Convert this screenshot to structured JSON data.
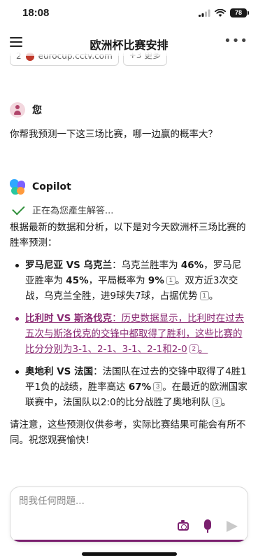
{
  "status_bar": {
    "time": "18:08",
    "battery": "78"
  },
  "header": {
    "title": "欧洲杯比赛安排"
  },
  "sources": [
    {
      "num": "2",
      "label": "eurocup.cctv.com"
    },
    {
      "num": "",
      "label": "+3 更多"
    }
  ],
  "user": {
    "name": "您",
    "message": "你帮我预测一下这三场比赛，哪一边赢的概率大？"
  },
  "copilot": {
    "name": "Copilot",
    "status": "正在為您產生解答...",
    "intro": "根据最新的数据和分析，以下是对今天欧洲杯三场比赛的胜率预测：",
    "items": [
      {
        "title": "罗马尼亚 VS 乌克兰",
        "t1": "：乌克兰胜率为 ",
        "p1": "46%",
        "t2": "，罗马尼亚胜率为 ",
        "p2": "45%",
        "t3": "，平局概率为 ",
        "p3": "9%",
        "cite1": "1",
        "t4": "。双方近3次交战，乌克兰全胜，进9球失7球，占据优势",
        "cite2": "1",
        "t5": "。"
      },
      {
        "title": "比利时 VS 斯洛伐克",
        "t1": "：历史数据显示，比利时在过去五次与斯洛伐克的交锋中都取得了胜利，这些比赛的比分分别为3-1、2-1、3-1、2-1和2-0",
        "cite1": "2",
        "t2": "。"
      },
      {
        "title": "奥地利 VS 法国",
        "t1": "：法国队在过去的交锋中取得了4胜1平1负的战绩，胜率高达 ",
        "p1": "67%",
        "cite1": "3",
        "t2": "。在最近的欧洲国家联赛中，法国队以2:0的比分战胜了奥地利队",
        "cite2": "3",
        "t3": "。"
      }
    ],
    "outro": "请注意，这些预测仅供参考，实际比赛结果可能会有所不同。祝您观赛愉快！"
  },
  "input": {
    "placeholder": "問我任何問題..."
  },
  "colors": {
    "accent": "#7a1f6e",
    "link": "#8a2a73",
    "check": "#2f8f3a"
  },
  "icons": [
    "menu-icon",
    "more-icon",
    "check-icon",
    "camera-icon",
    "mic-icon",
    "send-icon"
  ]
}
